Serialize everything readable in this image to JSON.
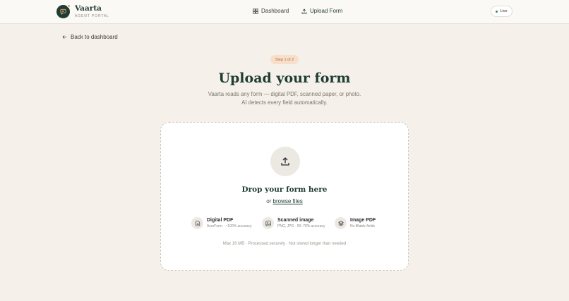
{
  "brand": {
    "name": "Vaarta",
    "subtitle": "AGENT PORTAL"
  },
  "nav": {
    "dashboard": "Dashboard",
    "upload": "Upload Form"
  },
  "status": {
    "label": "Live",
    "color": "#2f8a5b"
  },
  "back_link": "Back to dashboard",
  "step": "Step 1 of 2",
  "title": "Upload your form",
  "subtitle_line1": "Vaarta reads any form — digital PDF, scanned paper, or photo.",
  "subtitle_line2": "AI detects every field automatically.",
  "dropzone": {
    "title": "Drop your form here",
    "or_text": "or",
    "browse_label": "browse files",
    "formats": [
      {
        "name": "Digital PDF",
        "desc": "AcroForm · ~100% accuracy",
        "icon": "document-icon"
      },
      {
        "name": "Scanned image",
        "desc": "PNG, JPG · 50–70% accuracy",
        "icon": "image-icon"
      },
      {
        "name": "Image PDF",
        "desc": "No fillable fields",
        "icon": "layers-icon"
      }
    ],
    "footnote": "Max 16 MB · Processed securely · Not stored longer than needed"
  },
  "colors": {
    "brand": "#1f3d34",
    "background": "#f5f1ea",
    "accent": "#e2a36f"
  }
}
